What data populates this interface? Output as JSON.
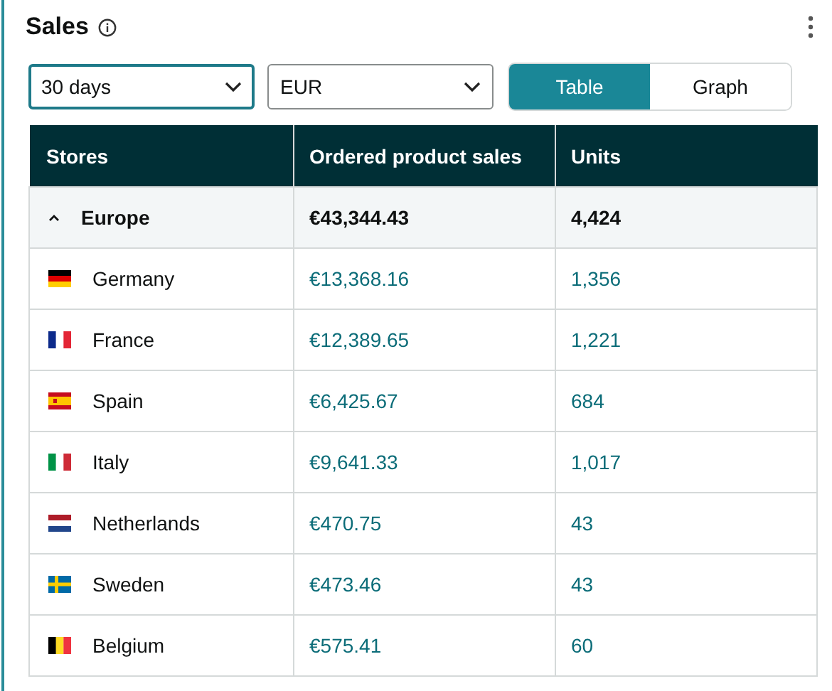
{
  "card": {
    "title": "Sales"
  },
  "filters": [
    {
      "value": "30 days",
      "focused": true
    },
    {
      "value": "EUR",
      "focused": false
    }
  ],
  "view_toggle": [
    {
      "label": "Table",
      "selected": true
    },
    {
      "label": "Graph",
      "selected": false
    }
  ],
  "table": {
    "columns": [
      "Stores",
      "Ordered product sales",
      "Units"
    ],
    "groups": [
      {
        "name": "Europe",
        "sales": "€43,344.43",
        "units": "4,424",
        "expanded": true,
        "rows": [
          {
            "kind": "de",
            "store": "Germany",
            "sales": "€13,368.16",
            "units": "1,356"
          },
          {
            "kind": "fr",
            "store": "France",
            "sales": "€12,389.65",
            "units": "1,221"
          },
          {
            "kind": "es",
            "store": "Spain",
            "sales": "€6,425.67",
            "units": "684"
          },
          {
            "kind": "it",
            "store": "Italy",
            "sales": "€9,641.33",
            "units": "1,017"
          },
          {
            "kind": "nl",
            "store": "Netherlands",
            "sales": "€470.75",
            "units": "43"
          },
          {
            "kind": "se",
            "store": "Sweden",
            "sales": "€473.46",
            "units": "43"
          },
          {
            "kind": "be",
            "store": "Belgium",
            "sales": "€575.41",
            "units": "60"
          }
        ]
      }
    ]
  }
}
